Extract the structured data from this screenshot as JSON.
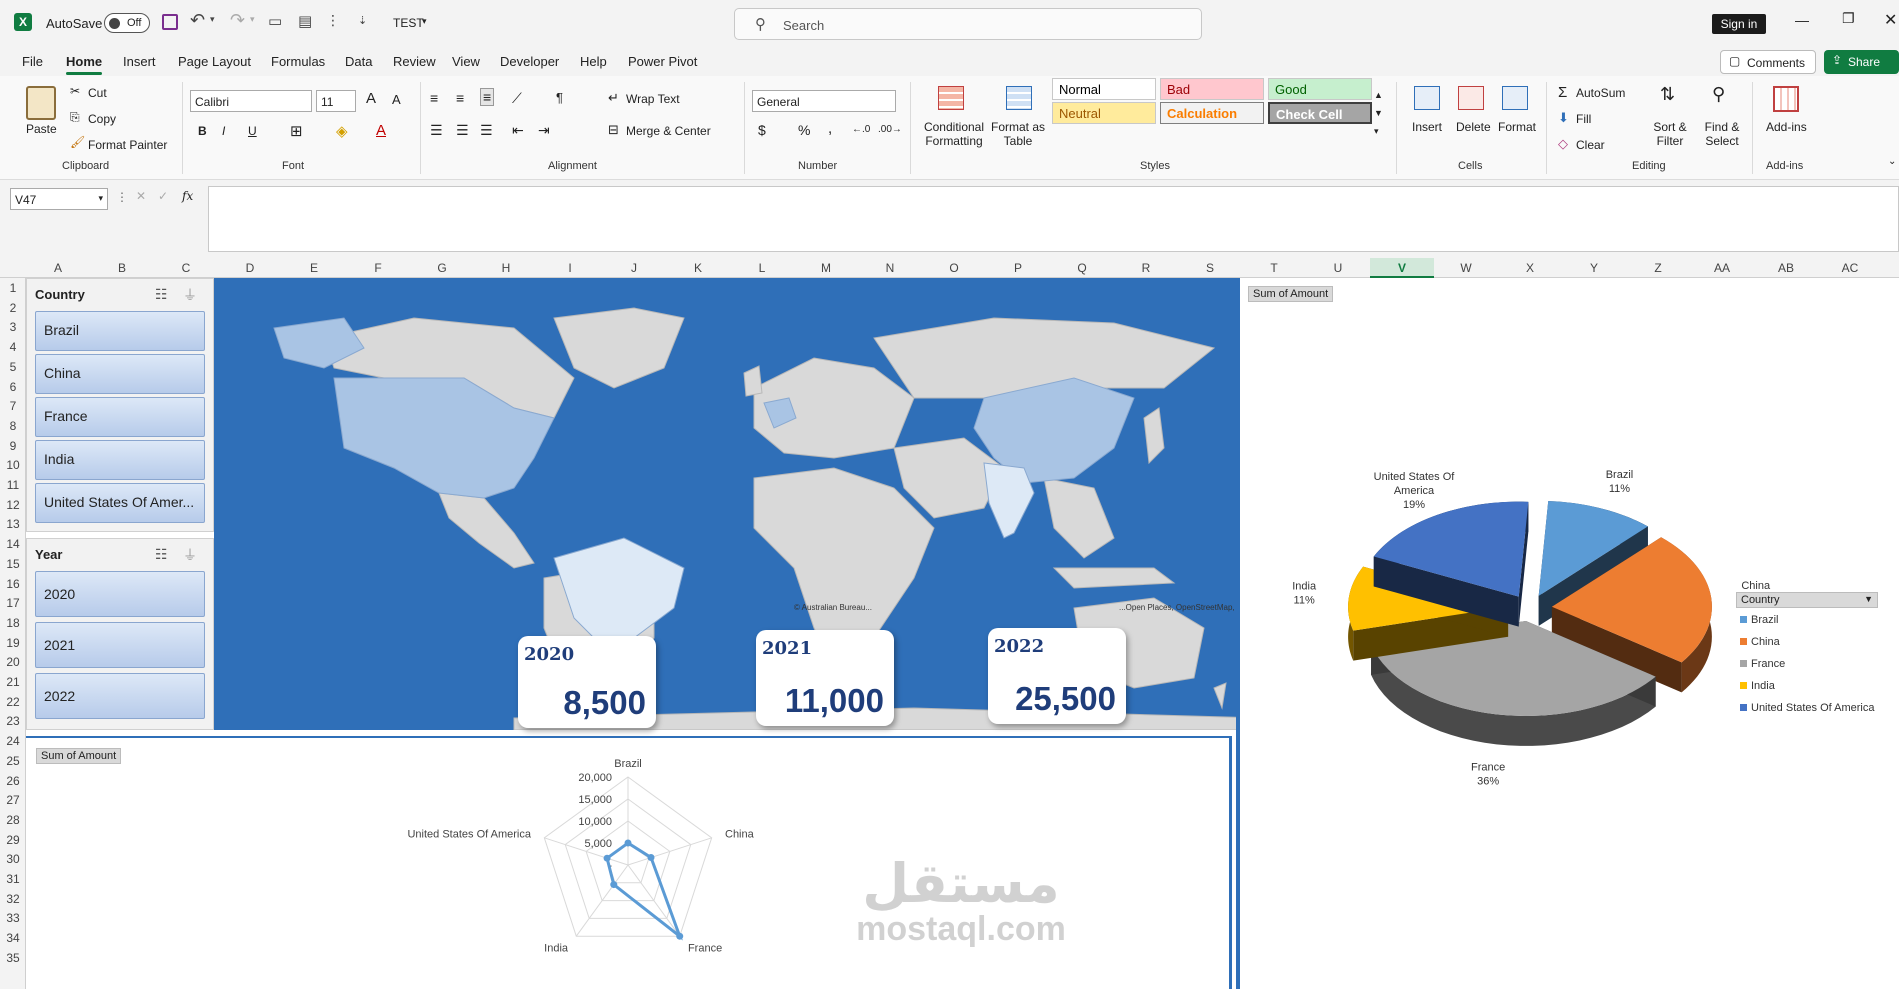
{
  "titlebar": {
    "autosave_label": "AutoSave",
    "autosave_state": "Off",
    "file_name": "TEST",
    "search_placeholder": "Search",
    "sign_in": "Sign in"
  },
  "tabs": [
    "File",
    "Home",
    "Insert",
    "Page Layout",
    "Formulas",
    "Data",
    "Review",
    "View",
    "Developer",
    "Help",
    "Power Pivot"
  ],
  "active_tab": "Home",
  "actions": {
    "comments": "Comments",
    "share": "Share"
  },
  "ribbon": {
    "clipboard": {
      "paste": "Paste",
      "cut": "Cut",
      "copy": "Copy",
      "format_painter": "Format Painter",
      "label": "Clipboard"
    },
    "font": {
      "name": "Calibri",
      "size": "11",
      "label": "Font"
    },
    "alignment": {
      "wrap_text": "Wrap Text",
      "merge_center": "Merge & Center",
      "label": "Alignment"
    },
    "number": {
      "format": "General",
      "label": "Number"
    },
    "styles": {
      "conditional": "Conditional Formatting",
      "format_table": "Format as Table",
      "cells": [
        {
          "text": "Normal",
          "bg": "#ffffff",
          "color": "#000000"
        },
        {
          "text": "Bad",
          "bg": "#ffc7ce",
          "color": "#9c0006"
        },
        {
          "text": "Good",
          "bg": "#c6efce",
          "color": "#006100"
        },
        {
          "text": "Neutral",
          "bg": "#ffeb9c",
          "color": "#9c5700"
        },
        {
          "text": "Calculation",
          "bg": "#f2f2f2",
          "color": "#fa7d00"
        },
        {
          "text": "Check Cell",
          "bg": "#a5a5a5",
          "color": "#ffffff"
        }
      ],
      "label": "Styles"
    },
    "cells": {
      "insert": "Insert",
      "delete": "Delete",
      "format": "Format",
      "label": "Cells"
    },
    "editing": {
      "autosum": "AutoSum",
      "fill": "Fill",
      "clear": "Clear",
      "sort_filter": "Sort & Filter",
      "find_select": "Find & Select",
      "label": "Editing"
    },
    "addins": {
      "addins": "Add-ins",
      "label": "Add-ins"
    }
  },
  "formula_bar": {
    "name_box": "V47",
    "fx": "fx",
    "content": ""
  },
  "columns": [
    "A",
    "B",
    "C",
    "D",
    "E",
    "F",
    "G",
    "H",
    "I",
    "J",
    "K",
    "L",
    "M",
    "N",
    "O",
    "P",
    "Q",
    "R",
    "S",
    "T",
    "U",
    "V",
    "W",
    "X",
    "Y",
    "Z",
    "AA",
    "AB",
    "AC"
  ],
  "selected_column": "V",
  "rows": [
    "1",
    "2",
    "3",
    "4",
    "5",
    "6",
    "7",
    "8",
    "9",
    "10",
    "11",
    "12",
    "13",
    "14",
    "15",
    "16",
    "17",
    "18",
    "19",
    "20",
    "21",
    "22",
    "23",
    "24",
    "25",
    "26",
    "27",
    "28",
    "29",
    "30",
    "31",
    "32",
    "33",
    "34",
    "35"
  ],
  "slicer_country": {
    "title": "Country",
    "items": [
      "Brazil",
      "China",
      "France",
      "India",
      "United States Of Amer..."
    ]
  },
  "slicer_year": {
    "title": "Year",
    "items": [
      "2020",
      "2021",
      "2022"
    ]
  },
  "map": {
    "credit": "© Australian Bureau...",
    "credit2": "...Open Places, OpenStreetMap, T...",
    "highlight": "#a9c4e4",
    "ocean": "#2f6fb8",
    "land": "#d9d9d9"
  },
  "kpis": [
    {
      "year": "2020",
      "value": "8,500"
    },
    {
      "year": "2021",
      "value": "11,000"
    },
    {
      "year": "2022",
      "value": "25,500"
    }
  ],
  "watermark": {
    "arabic": "مستقل",
    "latin": "mostaql.com"
  },
  "chart_data": [
    {
      "type": "radar",
      "title": "Sum of Amount",
      "categories": [
        "Brazil",
        "China",
        "France",
        "India",
        "United States Of America"
      ],
      "values": [
        5000,
        5500,
        20000,
        5500,
        5000
      ],
      "ticks": [
        "20,000",
        "15,000",
        "10,000",
        "5,000",
        "-"
      ],
      "rmax": 20000,
      "color": "#5b9bd5"
    },
    {
      "type": "pie",
      "title": "Sum of Amount",
      "legend_title": "Country",
      "legend_position": "right",
      "slices": [
        {
          "name": "Brazil",
          "pct_label": "11%",
          "value": 11,
          "color": "#5b9bd5"
        },
        {
          "name": "China",
          "pct_label": "23%",
          "value": 23,
          "color": "#ed7d31"
        },
        {
          "name": "France",
          "pct_label": "36%",
          "value": 36,
          "color": "#a5a5a5"
        },
        {
          "name": "India",
          "pct_label": "11%",
          "value": 11,
          "color": "#ffc000"
        },
        {
          "name": "United States Of America",
          "pct_label": "19%",
          "value": 19,
          "color": "#4472c4"
        }
      ]
    }
  ]
}
